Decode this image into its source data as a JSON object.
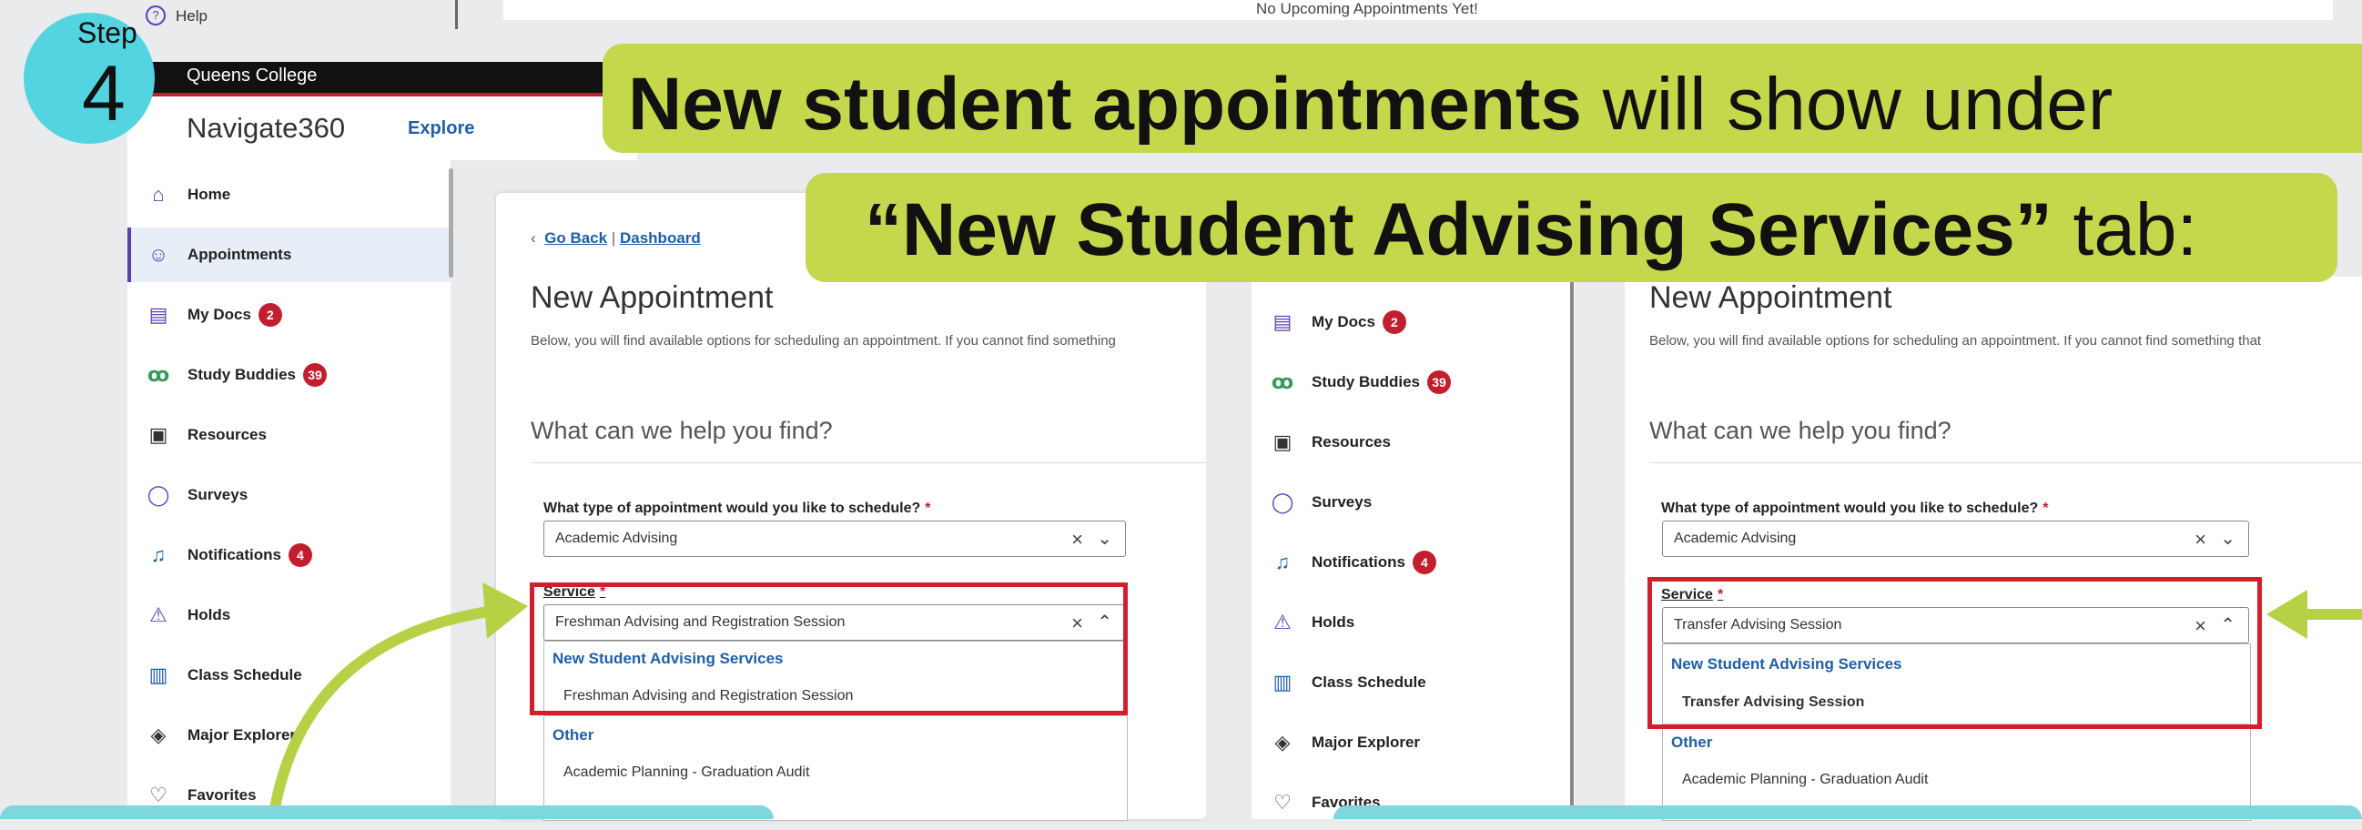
{
  "step": {
    "word": "Step",
    "number": "4"
  },
  "top": {
    "help": "Help",
    "no_appointments": "No Upcoming Appointments Yet!"
  },
  "app": {
    "college": "Queens College",
    "logo": "Navigate360",
    "explore": "Explore"
  },
  "headline": {
    "line1_bold": "New student appointments",
    "line1_rest": " will show under",
    "line2_bold": "“New Student Advising Services”",
    "line2_rest": " tab:"
  },
  "nav": {
    "home": "Home",
    "appointments": "Appointments",
    "mydocs": "My Docs",
    "mydocs_badge": "2",
    "study": "Study Buddies",
    "study_badge": "39",
    "resources": "Resources",
    "surveys": "Surveys",
    "notifications": "Notifications",
    "notifications_badge": "4",
    "holds": "Holds",
    "class_schedule": "Class Schedule",
    "major_explorer": "Major Explorer",
    "favorites": "Favorites"
  },
  "left_panel": {
    "go_back": "Go Back",
    "sep": "|",
    "dashboard": "Dashboard",
    "title": "New Appointment",
    "desc": "Below, you will find available options for scheduling an appointment. If you cannot find something",
    "question": "What can we help you find?",
    "type_label": "What type of appointment would you like to schedule?",
    "type_value": "Academic Advising",
    "service_label": "Service",
    "service_value": "Freshman Advising and Registration Session",
    "group1": "New Student Advising Services",
    "group1_item": "Freshman Advising and Registration Session",
    "group2": "Other",
    "group2_item": "Academic Planning - Graduation Audit"
  },
  "right_panel": {
    "title": "New Appointment",
    "desc": "Below, you will find available options for scheduling an appointment. If you cannot find something that",
    "question": "What can we help you find?",
    "type_label": "What type of appointment would you like to schedule?",
    "type_value": "Academic Advising",
    "service_label": "Service",
    "service_value": "Transfer Advising Session",
    "group1": "New Student Advising Services",
    "group1_item": "Transfer Advising Session",
    "group2": "Other",
    "group2_item": "Academic Planning - Graduation Audit"
  },
  "colors": {
    "accent_green": "#c5d84c",
    "step_teal": "#53d4e0",
    "highlight_red": "#d21f2e",
    "nav_purple": "#5a3fb1"
  }
}
